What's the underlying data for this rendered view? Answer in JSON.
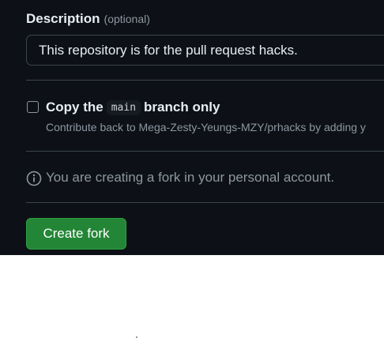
{
  "description": {
    "label": "Description",
    "optional": "(optional)",
    "value": "This repository is for the pull request hacks."
  },
  "copy_branch": {
    "prefix": "Copy the",
    "branch": "main",
    "suffix": "branch only",
    "checked": false,
    "hint": "Contribute back to Mega-Zesty-Yeungs-MZY/prhacks by adding y"
  },
  "info": {
    "icon": "info-icon",
    "text": "You are creating a fork in your personal account."
  },
  "create_button": {
    "label": "Create fork"
  },
  "colors": {
    "background": "#0d1117",
    "border": "#3d444d",
    "primary_button": "#238636",
    "muted_text": "#8d96a0"
  }
}
